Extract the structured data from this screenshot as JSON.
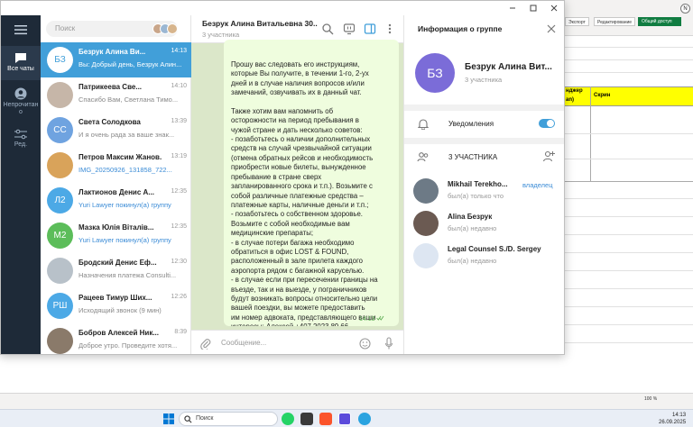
{
  "excel": {
    "buttons": [
      "Экспорт",
      "Редактирование",
      "Общий доступ"
    ],
    "avatar_letter": "N",
    "headers": [
      "нджер",
      "Скрин",
      "an)"
    ],
    "zoom": "100 %"
  },
  "taskbar": {
    "search_placeholder": "Поиск",
    "time": "14:13",
    "date": "26.09.2025"
  },
  "telegram": {
    "nav": [
      {
        "label": "Все чаты",
        "icon": "chat-bubble-icon"
      },
      {
        "label": "Непрочитано",
        "icon": "person-icon"
      },
      {
        "label": "Ред.",
        "icon": "sliders-icon"
      }
    ],
    "search_placeholder": "Поиск",
    "chats": [
      {
        "initials": "БЗ",
        "name": "Безрук Алина Ви...",
        "time": "14:13",
        "preview": "Вы: Добрый день, Безрук Алин...",
        "color": "#ffffff",
        "active": true,
        "group": true,
        "read": true
      },
      {
        "initials": "",
        "name": "Патрикеева Све...",
        "time": "14:10",
        "preview": "Спасибо Вам, Светлана Тимо...",
        "color": "#c6b6a8",
        "active": false,
        "read": true
      },
      {
        "initials": "СС",
        "name": "Света Солодкова",
        "time": "13:39",
        "preview": "И я очень рада за ваше знак...",
        "color": "#6fa3e0",
        "active": false
      },
      {
        "initials": "",
        "name": "Петров Максим Жанов...",
        "time": "13:19",
        "preview": "IMG_20250926_131858_722...",
        "color": "#d9a35a",
        "active": false
      },
      {
        "initials": "Л2",
        "name": "Лактионов Денис А...",
        "time": "12:35",
        "preview": "Yuri Lawyer покинул(а) группу",
        "color": "#4ca9e6",
        "active": false,
        "group": true
      },
      {
        "initials": "М2",
        "name": "Мазка Юлія Віталів...",
        "time": "12:35",
        "preview": "Yuri Lawyer покинул(а) группу",
        "color": "#5cbd5a",
        "active": false,
        "group": true
      },
      {
        "initials": "",
        "name": "Бродский Денис Еф...",
        "time": "12:30",
        "preview": "Назначения платежа Consulti...",
        "color": "#b8c1c9",
        "active": false,
        "read": true
      },
      {
        "initials": "РШ",
        "name": "Рацеев Тимур Ших...",
        "time": "12:26",
        "preview": "Исходящий звонок (9 мин)",
        "color": "#4ca9e6",
        "active": false,
        "read": true
      },
      {
        "initials": "",
        "name": "Бобров Алексей Ник...",
        "time": "8:39",
        "preview": "Доброе утро. Проведите хотя...",
        "color": "#8a7a6a",
        "active": false,
        "read": true
      }
    ],
    "chat": {
      "title": "Безрук Алина Витальевна 30....",
      "subtitle": "3 участника",
      "message": "Прошу вас следовать его инструкциям,\nкоторые Вы получите, в течении 1-го, 2-ух\nдней и в случае наличия вопросов и/или\nзамечаний, озвучивать их в данный чат.\n\nТакже хотим вам напомнить об\nосторожности на период пребывания в\nчужой стране и дать несколько советов:\n- позаботьтесь о наличии дополнительных\nсредств на случай чрезвычайной ситуации\n(отмена обратных рейсов и необходимость\nприобрести новые билеты, вынужденное\nпребывание в стране сверх\nзапланированного срока и т.п.). Возьмите с\nсобой различные платежные средства –\nплатежные карты, наличные деньги и т.п.;\n- позаботьтесь о собственном здоровье.\nВозьмите с собой необходимые вам\nмедицинские препараты;\n- в случае потери багажа необходимо\nобратиться в офис LOST & FOUND,\nрасположенный в зале прилета каждого\nаэропорта рядом с багажной каруселью.\n- в случае если при пересечении границы на\nвъезде, так и на выезде, у пограничников\nбудут возникать вопросы относительно цели\nвашей поездки, вы можете предоставить\nим номер адвоката, представляющего ваши\nинтересы: Алексей +407 2023 89 66",
      "time": "14:13",
      "input_placeholder": "Сообщение..."
    },
    "info": {
      "title": "Информация о группе",
      "initials": "БЗ",
      "name": "Безрук Алина Вит...",
      "members_count": "3 участника",
      "notifications_label": "Уведомления",
      "notifications_on": true,
      "members_label": "3 УЧАСТНИКА",
      "members": [
        {
          "name": "Mikhail Terekho...",
          "status": "был(а) только что",
          "role": "владелец",
          "color": "#6d7a86"
        },
        {
          "name": "Alina Безрук",
          "status": "был(а) недавно",
          "role": "",
          "color": "#6b5a52"
        },
        {
          "name": "Legal Counsel S./D. Sergey",
          "status": "был(а) недавно",
          "role": "",
          "color": "#dde6f2"
        }
      ]
    }
  }
}
